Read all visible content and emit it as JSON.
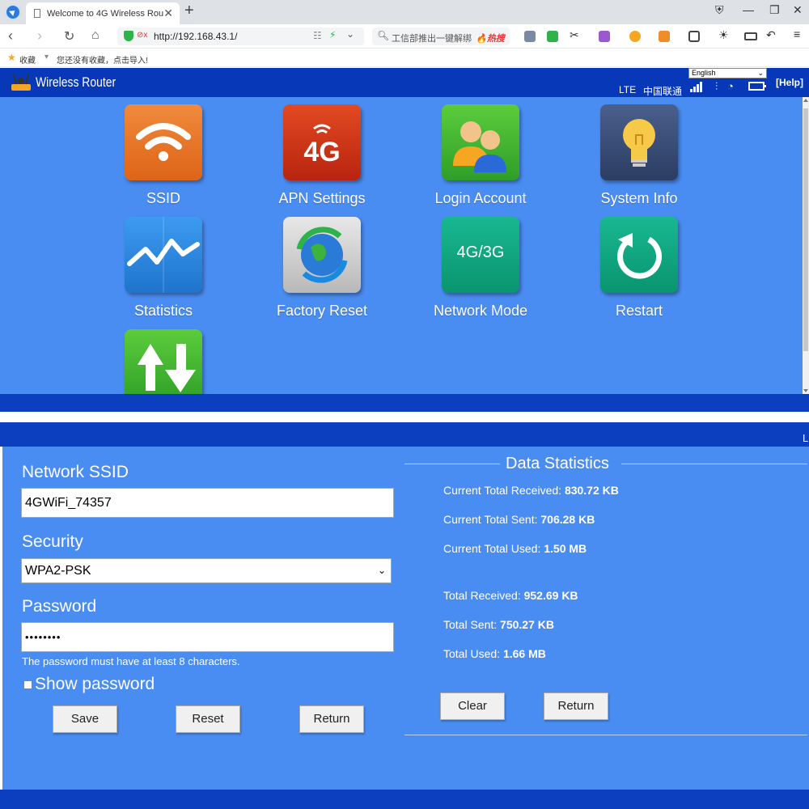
{
  "browser": {
    "tab_title": "Welcome to 4G Wireless Rou",
    "tab_close": "✕",
    "new_tab": "+",
    "url": "http://192.168.43.1/",
    "url_warning": "⊘x",
    "search_text": "工信部推出一键解绑",
    "search_hot": "🔥热搜",
    "bookmark_label": "收藏",
    "bookmark_hint": "您还没有收藏，点击导入!"
  },
  "router": {
    "title": "Wireless Router",
    "language": "English",
    "network_type": "LTE",
    "carrier": "中国联通",
    "help": "[Help]",
    "band_char": "L"
  },
  "tiles": [
    {
      "label": "SSID",
      "icon": "wifi-icon",
      "color": "#e8762a"
    },
    {
      "label": "APN Settings",
      "icon": "4g-icon",
      "color": "#d9361a"
    },
    {
      "label": "Login Account",
      "icon": "users-icon",
      "color": "#3cb43c"
    },
    {
      "label": "System Info",
      "icon": "lightbulb-icon",
      "color": "#3a4f7a"
    },
    {
      "label": "Statistics",
      "icon": "chart-icon",
      "color": "#2e8be0"
    },
    {
      "label": "Factory Reset",
      "icon": "globe-refresh-icon",
      "color": "#cfcfcf"
    },
    {
      "label": "Network Mode",
      "icon": "network-mode-icon",
      "color": "#10a882",
      "icon_text": "4G/3G"
    },
    {
      "label": "Restart",
      "icon": "restart-icon",
      "color": "#10a882"
    },
    {
      "label": "",
      "icon": "updown-arrows-icon",
      "color": "#3cb43c"
    }
  ],
  "wifi_form": {
    "ssid_label": "Network SSID",
    "ssid_value": "4GWiFi_74357",
    "security_label": "Security",
    "security_value": "WPA2-PSK",
    "password_label": "Password",
    "password_value": "••••••••",
    "password_hint": "The password must have at least 8 characters.",
    "show_password_label": "Show password",
    "save_label": "Save",
    "reset_label": "Reset",
    "return_label": "Return"
  },
  "stats": {
    "title": "Data Statistics",
    "current_received_label": "Current Total Received:",
    "current_received_value": "830.72 KB",
    "current_sent_label": "Current Total Sent:",
    "current_sent_value": "706.28 KB",
    "current_used_label": "Current Total Used:",
    "current_used_value": "1.50 MB",
    "total_received_label": "Total Received:",
    "total_received_value": "952.69 KB",
    "total_sent_label": "Total Sent:",
    "total_sent_value": "750.27 KB",
    "total_used_label": "Total Used:",
    "total_used_value": "1.66 MB",
    "clear_label": "Clear",
    "return_label": "Return"
  }
}
